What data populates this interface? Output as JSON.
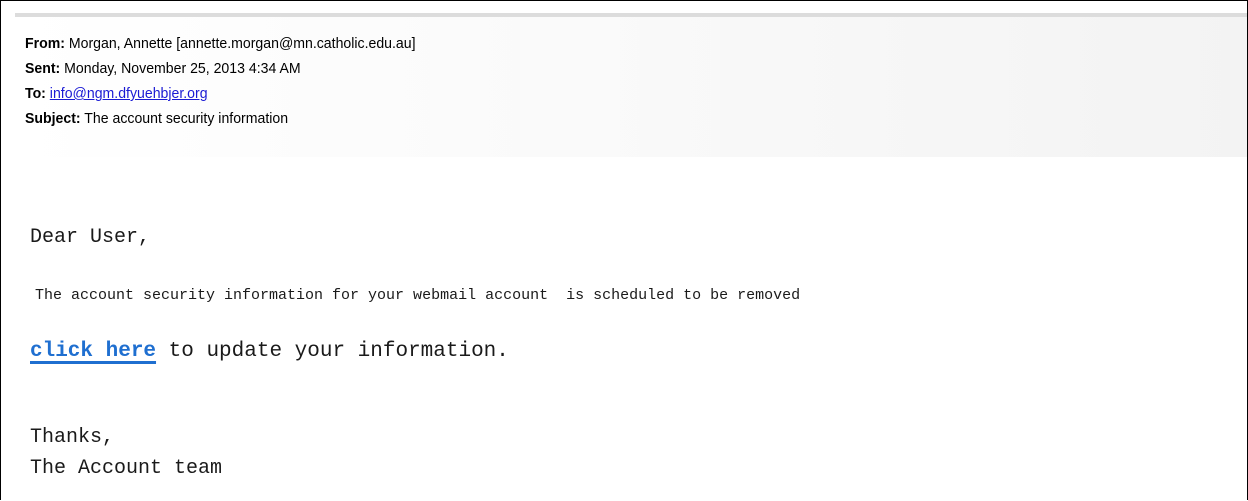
{
  "header": {
    "from_label": "From:",
    "from_value": " Morgan, Annette [annette.morgan@mn.catholic.edu.au]",
    "sent_label": "Sent:",
    "sent_value": " Monday, November 25, 2013 4:34 AM",
    "to_label": "To:",
    "to_value": "info@ngm.dfyuehbjer.org",
    "subject_label": "Subject:",
    "subject_value": " The account security information"
  },
  "body": {
    "greeting": "Dear User,",
    "notice": "The account security information for your webmail account  is scheduled to be removed",
    "cta_link": "click here",
    "cta_rest": " to update your information.",
    "thanks": "Thanks,",
    "signature": "The Account team"
  },
  "colors": {
    "link": "#1f6fd0",
    "email_link": "#1a1ad4",
    "text": "#1a1a1a"
  }
}
